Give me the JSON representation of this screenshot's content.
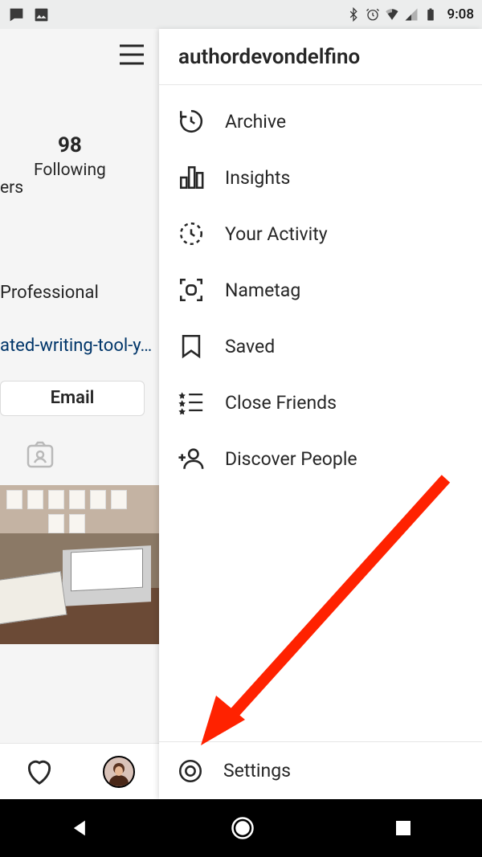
{
  "status": {
    "time": "9:08"
  },
  "profile": {
    "following_count": "98",
    "following_label": "Following",
    "followers_label_partial": "ers",
    "bio_partial": "Professional",
    "link_partial": "ated-writing-tool-y…",
    "email_button": "Email"
  },
  "drawer": {
    "username": "authordevondelfino",
    "items": [
      {
        "label": "Archive"
      },
      {
        "label": "Insights"
      },
      {
        "label": "Your Activity"
      },
      {
        "label": "Nametag"
      },
      {
        "label": "Saved"
      },
      {
        "label": "Close Friends"
      },
      {
        "label": "Discover People"
      }
    ],
    "settings_label": "Settings"
  }
}
